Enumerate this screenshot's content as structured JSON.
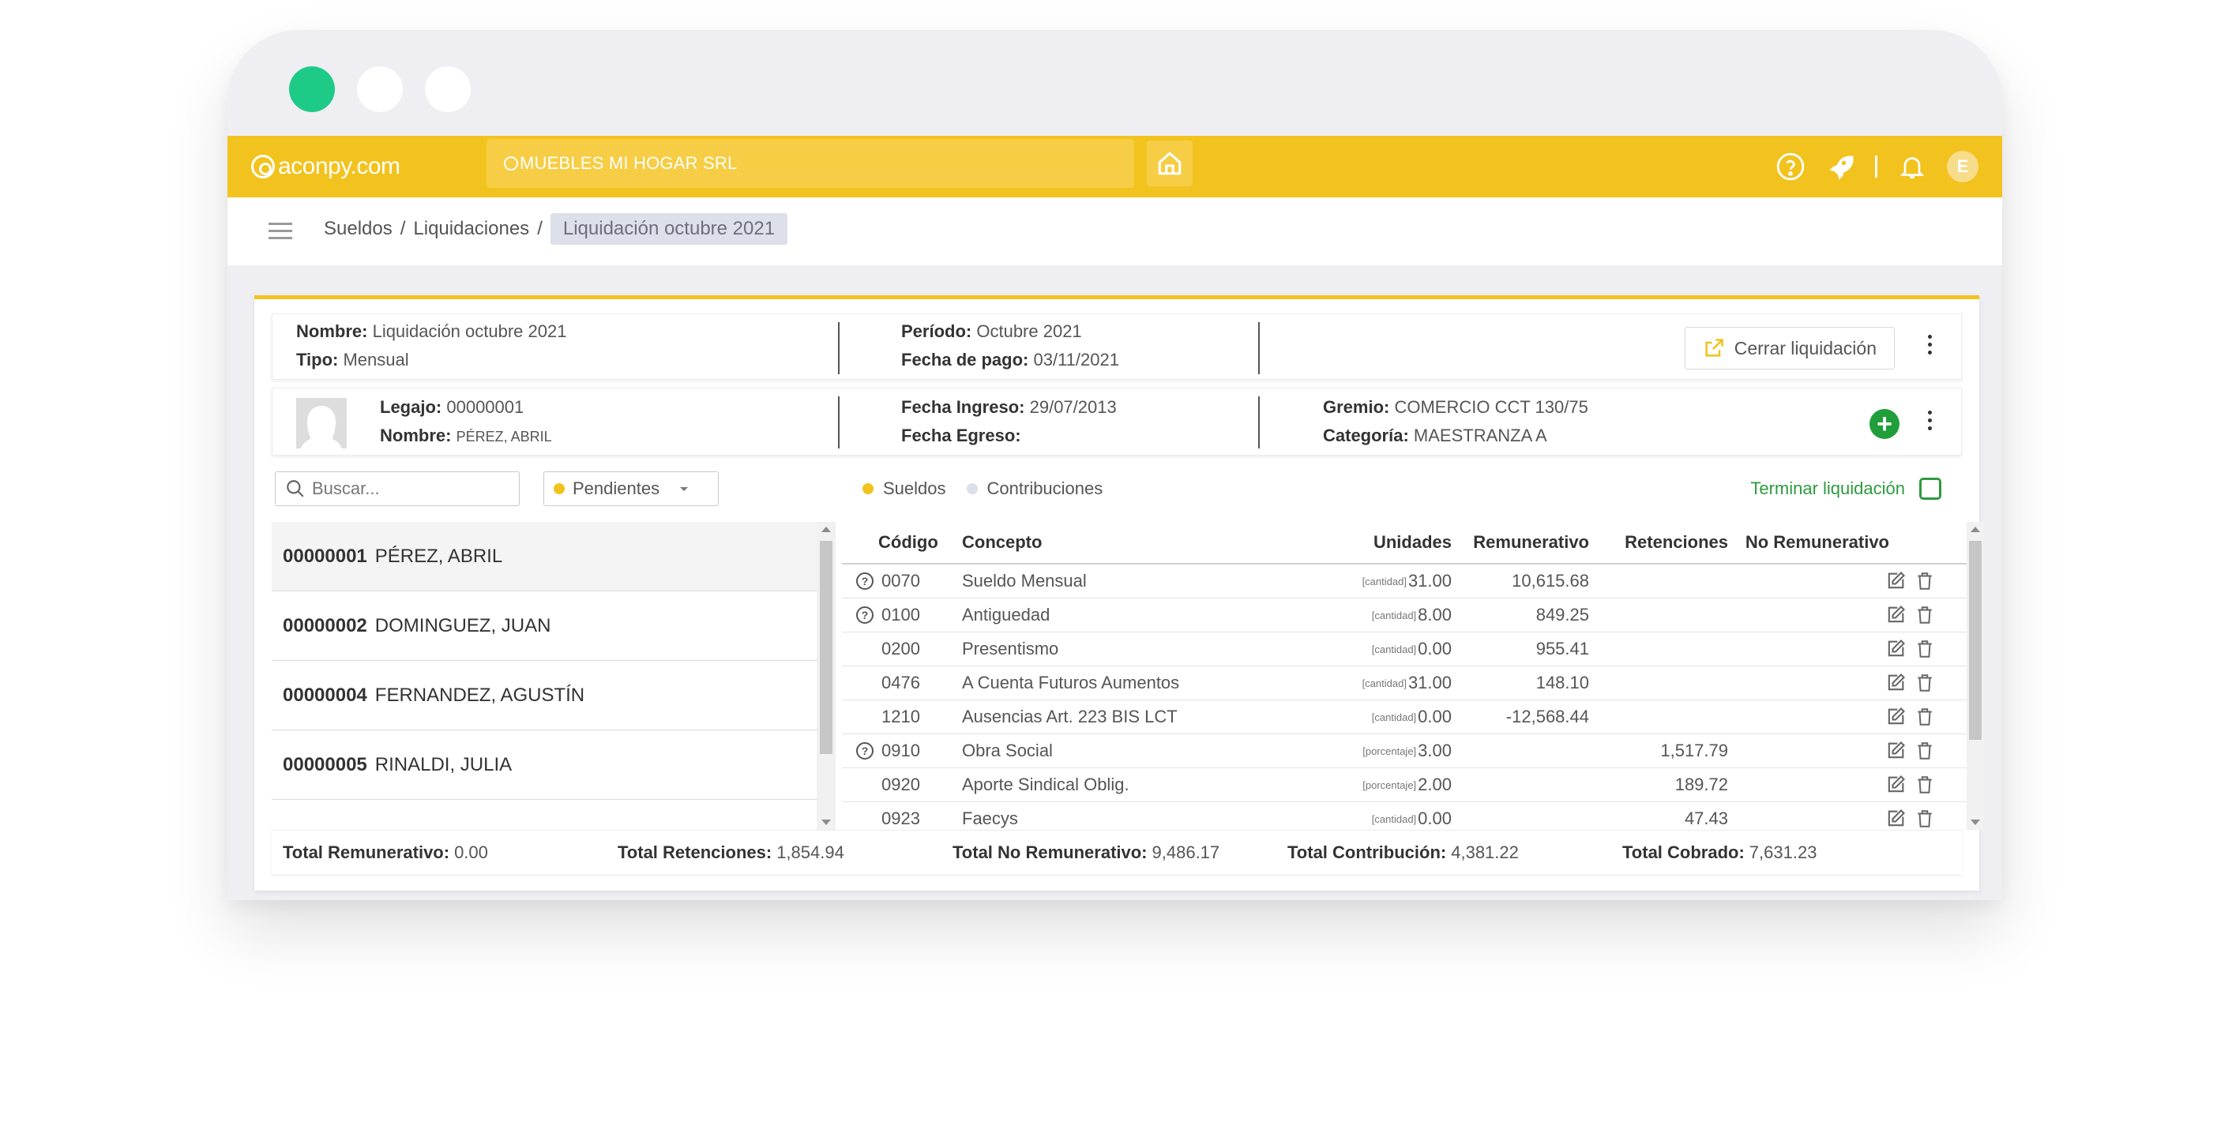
{
  "app": {
    "brand": "aconpy.com",
    "company": "MUEBLES MI HOGAR SRL",
    "user_initial": "E"
  },
  "breadcrumb": {
    "items": [
      "Sueldos",
      "Liquidaciones"
    ],
    "sep": "/",
    "active": "Liquidación octubre 2021"
  },
  "liquidacion": {
    "nombre_label": "Nombre:",
    "nombre": "Liquidación octubre 2021",
    "tipo_label": "Tipo:",
    "tipo": "Mensual",
    "periodo_label": "Período:",
    "periodo": "Octubre 2021",
    "fecha_pago_label": "Fecha de pago:",
    "fecha_pago": "03/11/2021",
    "cerrar_label": "Cerrar liquidación"
  },
  "empleado": {
    "legajo_label": "Legajo:",
    "legajo": "00000001",
    "nombre_label": "Nombre:",
    "nombre": "PÉREZ, ABRIL",
    "ingreso_label": "Fecha Ingreso:",
    "ingreso": "29/07/2013",
    "egreso_label": "Fecha Egreso:",
    "egreso": "",
    "gremio_label": "Gremio:",
    "gremio": "COMERCIO CCT 130/75",
    "categoria_label": "Categoría:",
    "categoria": "MAESTRANZA A"
  },
  "toolbar": {
    "search_placeholder": "Buscar...",
    "filter_value": "Pendientes",
    "legend_sueldos": "Sueldos",
    "legend_contribuciones": "Contribuciones",
    "terminar_label": "Terminar liquidación"
  },
  "employees": [
    {
      "legajo": "00000001",
      "nombre": "PÉREZ, ABRIL"
    },
    {
      "legajo": "00000002",
      "nombre": "DOMINGUEZ, JUAN"
    },
    {
      "legajo": "00000004",
      "nombre": "FERNANDEZ, AGUSTÍN"
    },
    {
      "legajo": "00000005",
      "nombre": "RINALDI, JULIA"
    }
  ],
  "table": {
    "headers": {
      "codigo": "Código",
      "concepto": "Concepto",
      "unidades": "Unidades",
      "remunerativo": "Remunerativo",
      "retenciones": "Retenciones",
      "no_remunerativo": "No Remunerativo"
    },
    "rows": [
      {
        "help": true,
        "codigo": "0070",
        "concepto": "Sueldo Mensual",
        "unidad_tipo": "[cantidad]",
        "unidades": "31.00",
        "remunerativo": "10,615.68",
        "retenciones": "",
        "no_remunerativo": ""
      },
      {
        "help": true,
        "codigo": "0100",
        "concepto": "Antiguedad",
        "unidad_tipo": "[cantidad]",
        "unidades": "8.00",
        "remunerativo": "849.25",
        "retenciones": "",
        "no_remunerativo": ""
      },
      {
        "help": false,
        "codigo": "0200",
        "concepto": "Presentismo",
        "unidad_tipo": "[cantidad]",
        "unidades": "0.00",
        "remunerativo": "955.41",
        "retenciones": "",
        "no_remunerativo": ""
      },
      {
        "help": false,
        "codigo": "0476",
        "concepto": "A Cuenta Futuros Aumentos",
        "unidad_tipo": "[cantidad]",
        "unidades": "31.00",
        "remunerativo": "148.10",
        "retenciones": "",
        "no_remunerativo": ""
      },
      {
        "help": false,
        "codigo": "1210",
        "concepto": "Ausencias Art. 223 BIS LCT",
        "unidad_tipo": "[cantidad]",
        "unidades": "0.00",
        "remunerativo": "-12,568.44",
        "retenciones": "",
        "no_remunerativo": ""
      },
      {
        "help": true,
        "codigo": "0910",
        "concepto": "Obra Social",
        "unidad_tipo": "[porcentaje]",
        "unidades": "3.00",
        "remunerativo": "",
        "retenciones": "1,517.79",
        "no_remunerativo": ""
      },
      {
        "help": false,
        "codigo": "0920",
        "concepto": "Aporte Sindical Oblig.",
        "unidad_tipo": "[porcentaje]",
        "unidades": "2.00",
        "remunerativo": "",
        "retenciones": "189.72",
        "no_remunerativo": ""
      },
      {
        "help": false,
        "codigo": "0923",
        "concepto": "Faecys",
        "unidad_tipo": "[cantidad]",
        "unidades": "0.00",
        "remunerativo": "",
        "retenciones": "47.43",
        "no_remunerativo": ""
      }
    ]
  },
  "totals": {
    "remunerativo_label": "Total Remunerativo:",
    "remunerativo": "0.00",
    "retenciones_label": "Total Retenciones:",
    "retenciones": "1,854.94",
    "no_remunerativo_label": "Total No Remunerativo:",
    "no_remunerativo": "9,486.17",
    "contribucion_label": "Total Contribución:",
    "contribucion": "4,381.22",
    "cobrado_label": "Total Cobrado:",
    "cobrado": "7,631.23"
  },
  "colors": {
    "accent": "#f2c31e",
    "green": "#1ecb86",
    "add_green": "#1f9e3b",
    "terminar_green": "#2e9a3e"
  }
}
